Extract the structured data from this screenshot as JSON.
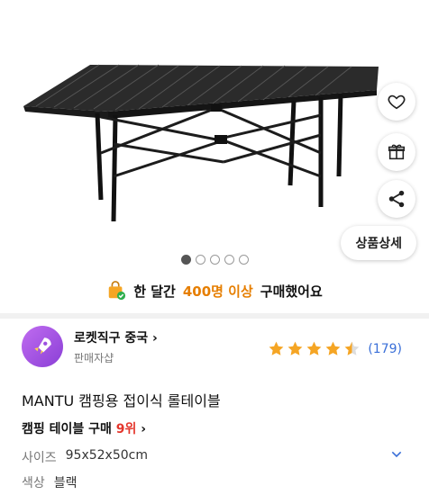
{
  "promo": {
    "prefix": "한 달간",
    "highlight": "400명 이상",
    "suffix": "구매했어요"
  },
  "actions": {
    "detail_label": "상품상세"
  },
  "carousel": {
    "count": 5,
    "active": 0
  },
  "seller": {
    "name": "로켓직구 중국",
    "sub": "판매자샵"
  },
  "rating": {
    "stars": 4.5,
    "count": "(179)"
  },
  "product": {
    "title": "MANTU 캠핑용 접이식 롤테이블"
  },
  "ranking": {
    "prefix": "캠핑 테이블 구매",
    "rank": "9위"
  },
  "options": [
    {
      "label": "사이즈",
      "value": "95x52x50cm"
    },
    {
      "label": "색상",
      "value": "블랙"
    }
  ],
  "colors": {
    "accent": "#e67e00",
    "rank": "#e4362c",
    "link": "#3a6fd8",
    "star": "#f5a524"
  }
}
